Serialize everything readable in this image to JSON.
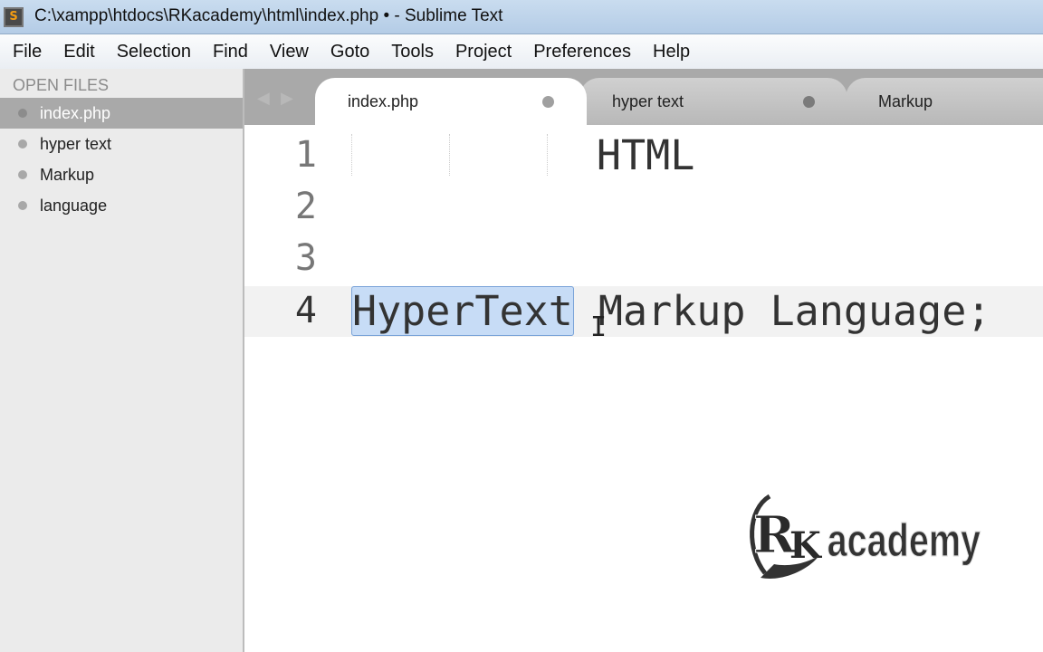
{
  "window": {
    "title": "C:\\xampp\\htdocs\\RKacademy\\html\\index.php • - Sublime Text",
    "icon": "sublime-icon",
    "icon_letter": "S"
  },
  "menu": [
    "File",
    "Edit",
    "Selection",
    "Find",
    "View",
    "Goto",
    "Tools",
    "Project",
    "Preferences",
    "Help"
  ],
  "sidebar": {
    "header": "OPEN FILES",
    "files": [
      "index.php",
      "hyper text",
      "Markup",
      "language"
    ],
    "active": 0
  },
  "tabs": [
    {
      "label": "index.php",
      "active": true,
      "dirty": true
    },
    {
      "label": "hyper text",
      "active": false,
      "dirty": true
    },
    {
      "label": "Markup",
      "active": false,
      "dirty": false
    }
  ],
  "editor": {
    "line_numbers": [
      "1",
      "2",
      "3",
      "4"
    ],
    "lines": [
      "          HTML",
      "",
      "",
      ""
    ],
    "line4": {
      "selected": "HyperText",
      "rest": " Markup Language;"
    }
  },
  "logo": {
    "text": "RK academy"
  }
}
